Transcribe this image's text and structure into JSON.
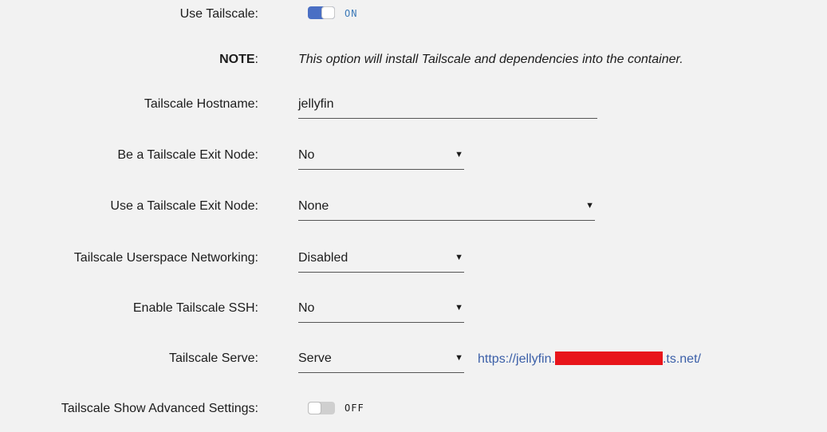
{
  "use_tailscale": {
    "label": "Use Tailscale:",
    "state": "ON"
  },
  "note": {
    "label": "NOTE",
    "colon": ":",
    "text": "This option will install Tailscale and dependencies into the container."
  },
  "hostname": {
    "label": "Tailscale Hostname:",
    "value": "jellyfin"
  },
  "exit_node_be": {
    "label": "Be a Tailscale Exit Node:",
    "value": "No"
  },
  "exit_node_use": {
    "label": "Use a Tailscale Exit Node:",
    "value": "None"
  },
  "userspace": {
    "label": "Tailscale Userspace Networking:",
    "value": "Disabled"
  },
  "ssh": {
    "label": "Enable Tailscale SSH:",
    "value": "No"
  },
  "serve": {
    "label": "Tailscale Serve:",
    "value": "Serve",
    "link_prefix": "https://jellyfin.",
    "link_suffix": ".ts.net/"
  },
  "advanced": {
    "label": "Tailscale Show Advanced Settings:",
    "state": "OFF"
  },
  "icons": {
    "dropdown_arrow": "▼"
  },
  "colors": {
    "toggle_on": "#4a6fc4",
    "toggle_on_text": "#3d7ab8",
    "link": "#3b5fa8",
    "redaction": "#e8151b"
  }
}
